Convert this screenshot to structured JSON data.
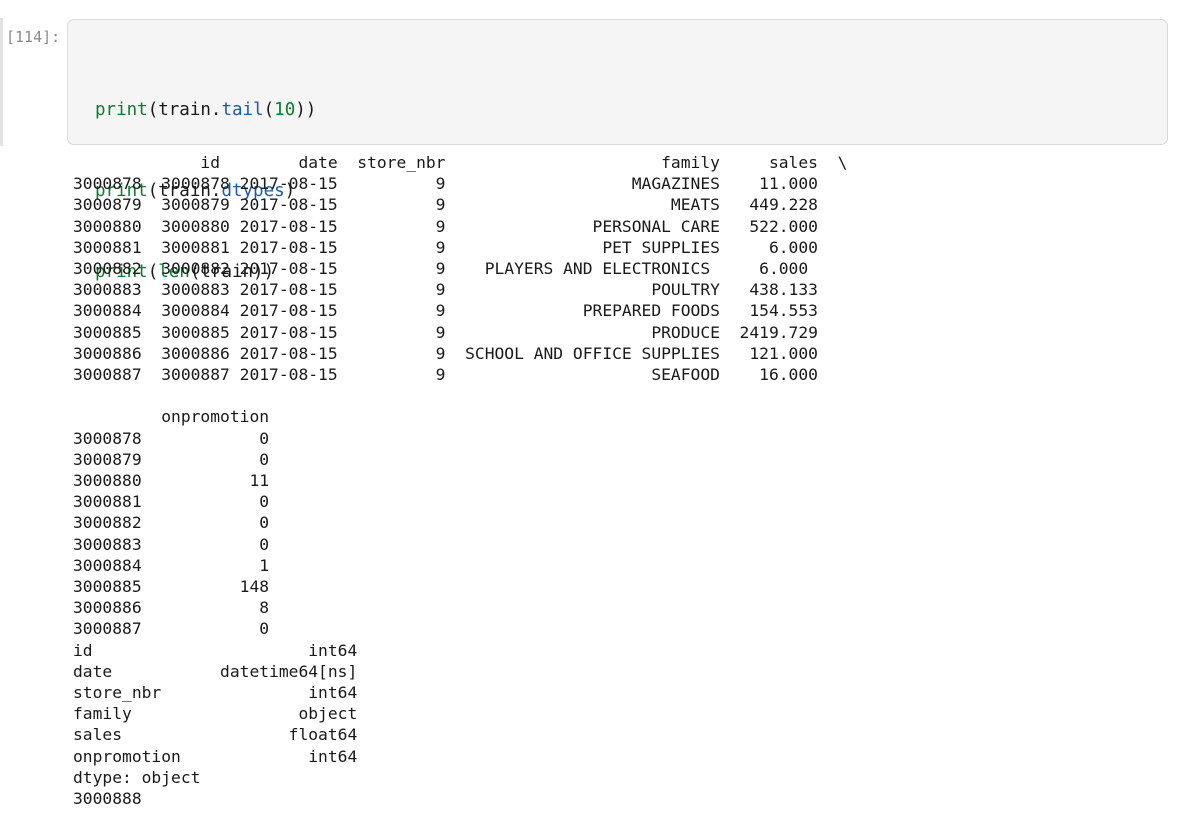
{
  "cell": {
    "prompt": "[114]:",
    "code": {
      "line1": {
        "fn": "print",
        "open": "(train.",
        "method": "tail",
        "paren": "(",
        "arg": "10",
        "close": "))"
      },
      "line2": {
        "fn": "print",
        "open": "(train.",
        "attr": "dtypes",
        "close": ")"
      },
      "line3": {
        "fn": "print",
        "open": "(",
        "inner_fn": "len",
        "rest": "(train))"
      }
    }
  },
  "output": {
    "tail_header": "             id        date  store_nbr                      family     sales  \\",
    "tail_rows": [
      "3000878  3000878 2017-08-15          9                   MAGAZINES    11.000",
      "3000879  3000879 2017-08-15          9                       MEATS   449.228",
      "3000880  3000880 2017-08-15          9               PERSONAL CARE   522.000",
      "3000881  3000881 2017-08-15          9                PET SUPPLIES     6.000",
      "3000882  3000882 2017-08-15          9    PLAYERS AND ELECTRONICS     6.000",
      "3000883  3000883 2017-08-15          9                     POULTRY   438.133",
      "3000884  3000884 2017-08-15          9              PREPARED FOODS   154.553",
      "3000885  3000885 2017-08-15          9                     PRODUCE  2419.729",
      "3000886  3000886 2017-08-15          9  SCHOOL AND OFFICE SUPPLIES   121.000",
      "3000887  3000887 2017-08-15          9                     SEAFOOD    16.000"
    ],
    "blank": "",
    "onpromo_header": "         onpromotion",
    "onpromo_rows": [
      "3000878            0",
      "3000879            0",
      "3000880           11",
      "3000881            0",
      "3000882            0",
      "3000883            0",
      "3000884            1",
      "3000885          148",
      "3000886            8",
      "3000887            0"
    ],
    "dtypes_rows": [
      "id                      int64",
      "date           datetime64[ns]",
      "store_nbr               int64",
      "family                 object",
      "sales                 float64",
      "onpromotion             int64",
      "dtype: object"
    ],
    "len_value": "3000888"
  }
}
